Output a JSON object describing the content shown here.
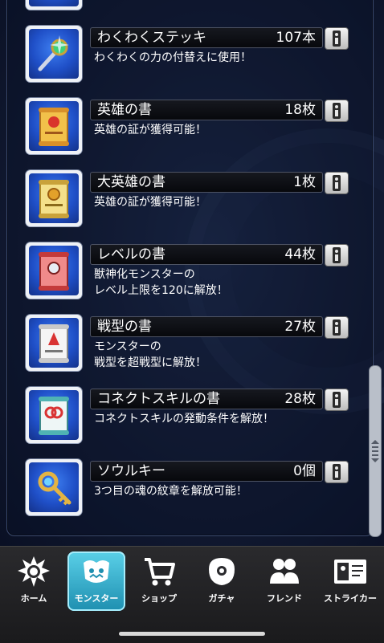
{
  "items": [
    {
      "name": "わくわくステッキ",
      "count": "107本",
      "desc": "わくわくの力の付替えに使用！",
      "icon": "sparkle-wand-icon"
    },
    {
      "name": "英雄の書",
      "count": "18枚",
      "desc": "英雄の証が獲得可能！",
      "icon": "hero-scroll-icon"
    },
    {
      "name": "大英雄の書",
      "count": "1枚",
      "desc": "英雄の証が獲得可能！",
      "icon": "great-hero-scroll-icon"
    },
    {
      "name": "レベルの書",
      "count": "44枚",
      "desc": "獣神化モンスターの\nレベル上限を120に解放！",
      "icon": "level-scroll-icon"
    },
    {
      "name": "戦型の書",
      "count": "27枚",
      "desc": "モンスターの\n戦型を超戦型に解放！",
      "icon": "battle-style-scroll-icon"
    },
    {
      "name": "コネクトスキルの書",
      "count": "28枚",
      "desc": "コネクトスキルの発動条件を解放！",
      "icon": "connect-skill-scroll-icon"
    },
    {
      "name": "ソウルキー",
      "count": "0個",
      "desc": "3つ目の魂の紋章を解放可能！",
      "icon": "soul-key-icon"
    }
  ],
  "nav": [
    {
      "label": "ホーム",
      "icon": "home-icon",
      "active": false
    },
    {
      "label": "モンスター",
      "icon": "monster-icon",
      "active": true
    },
    {
      "label": "ショップ",
      "icon": "shop-cart-icon",
      "active": false
    },
    {
      "label": "ガチャ",
      "icon": "gacha-icon",
      "active": false
    },
    {
      "label": "フレンド",
      "icon": "friend-icon",
      "active": false
    },
    {
      "label": "ストライカー",
      "icon": "striker-card-icon",
      "active": false
    }
  ]
}
